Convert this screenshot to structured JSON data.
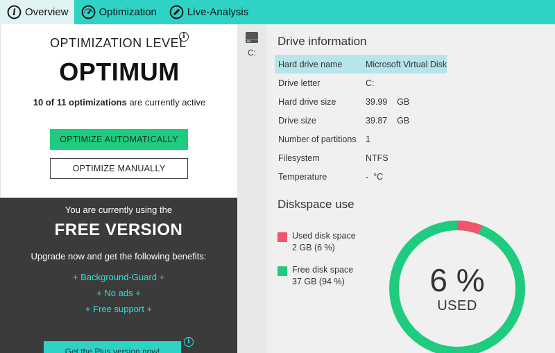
{
  "tabs": [
    {
      "label": "Overview",
      "icon": "info-icon"
    },
    {
      "label": "Optimization",
      "icon": "speedometer-icon"
    },
    {
      "label": "Live-Analysis",
      "icon": "pencil-icon"
    }
  ],
  "optimization": {
    "heading": "OPTIMIZATION LEVEL",
    "level": "OPTIMUM",
    "active_bold": "10 of 11 optimizations",
    "active_rest": " are currently active",
    "auto_button": "OPTIMIZE AUTOMATICALLY",
    "manual_button": "OPTIMIZE MANUALLY"
  },
  "upgrade": {
    "line1": "You are currently using the",
    "version": "FREE VERSION",
    "line2": "Upgrade now and get the following benefits:",
    "benefits": [
      "+ Background-Guard +",
      "+ No ads +",
      "+ Free support +"
    ],
    "button": "Get the Plus version now!"
  },
  "drives": [
    {
      "label": "C:"
    }
  ],
  "drive_info": {
    "title": "Drive information",
    "rows": [
      {
        "key": "Hard drive name",
        "value": "Microsoft Virtual Disk"
      },
      {
        "key": "Drive letter",
        "value": "C:"
      },
      {
        "key": "Hard drive size",
        "value": "39.99    GB"
      },
      {
        "key": "Drive size",
        "value": "39.87    GB"
      },
      {
        "key": "Number of partitions",
        "value": "1"
      },
      {
        "key": "Filesystem",
        "value": "NTFS"
      },
      {
        "key": "Temperature",
        "value": "-  °C"
      }
    ]
  },
  "diskspace": {
    "title": "Diskspace use",
    "used_label": "Used disk space",
    "used_value": "2 GB (6 %)",
    "free_label": "Free disk space",
    "free_value": "37 GB (94 %)",
    "percent_text": "6 %",
    "used_caption": "USED",
    "used_fraction": 0.06
  },
  "colors": {
    "accent": "#2ed3c6",
    "used": "#f0566a",
    "free": "#1fcb7e",
    "dark_panel": "#3b3b3b"
  }
}
